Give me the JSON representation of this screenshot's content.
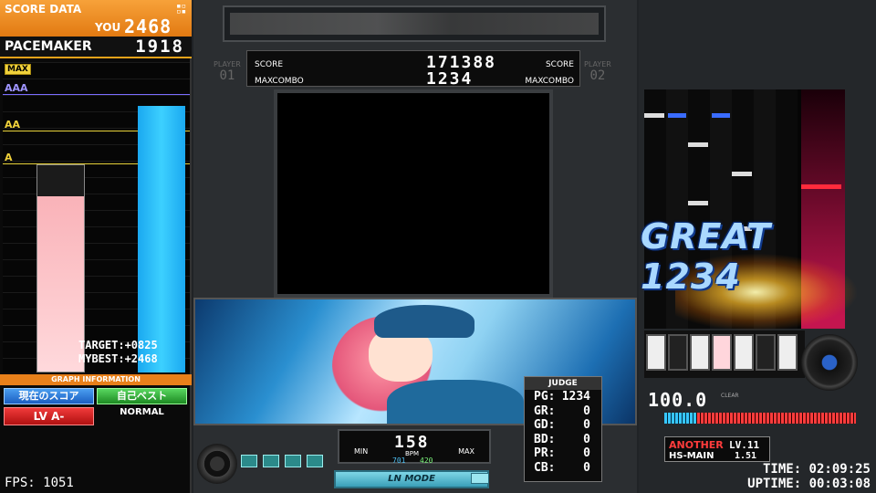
{
  "score_panel": {
    "title": "SCORE DATA",
    "you_label": "YOU",
    "you_score": "2468",
    "pacemaker_label": "PACEMAKER",
    "pacemaker_score": "1918",
    "grade_labels": [
      "MAX",
      "AAA",
      "AA",
      "A"
    ],
    "target_line": "TARGET:+0825",
    "mybest_line": "MYBEST:+2468",
    "graph_info": "GRAPH INFORMATION",
    "btn_current": "現在のスコア",
    "btn_best": "自己ベスト",
    "btn_level": "LV A-",
    "mode": "NORMAL",
    "fps": "FPS: 1051",
    "colors": {
      "you_bar": "#1aa8f0",
      "mybest_bar": "#f9b2b8",
      "header": "#f7a23a"
    }
  },
  "scoreboard": {
    "player1_label": "PLAYER",
    "player1_num": "01",
    "player2_label": "PLAYER",
    "player2_num": "02",
    "score_left": "SCORE",
    "score_value": "171388",
    "score_right": "SCORE",
    "combo_left": "MAXCOMBO",
    "combo_value": "1234",
    "combo_right": "MAXCOMBO"
  },
  "judge": {
    "header": "JUDGE",
    "rows": [
      {
        "label": "PG:",
        "value": "1234"
      },
      {
        "label": "GR:",
        "value": "0"
      },
      {
        "label": "GD:",
        "value": "0"
      },
      {
        "label": "BD:",
        "value": "0"
      },
      {
        "label": "PR:",
        "value": "0"
      },
      {
        "label": "CB:",
        "value": "0"
      }
    ]
  },
  "bpm": {
    "value": "158",
    "min_label": "MIN",
    "max_label": "MAX",
    "label": "BPM",
    "low": "701",
    "high": "420"
  },
  "ln_mode": "LN MODE",
  "playfield": {
    "judge_text": "GREAT 1234",
    "gauge_value": "100.0",
    "gauge_label": "CLEAR",
    "difficulty": "ANOTHER",
    "level": "LV.11",
    "hs_label": "HS-MAIN",
    "hs_value": "1.51",
    "time": "TIME: 02:09:25",
    "uptime": "UPTIME: 00:03:08"
  }
}
